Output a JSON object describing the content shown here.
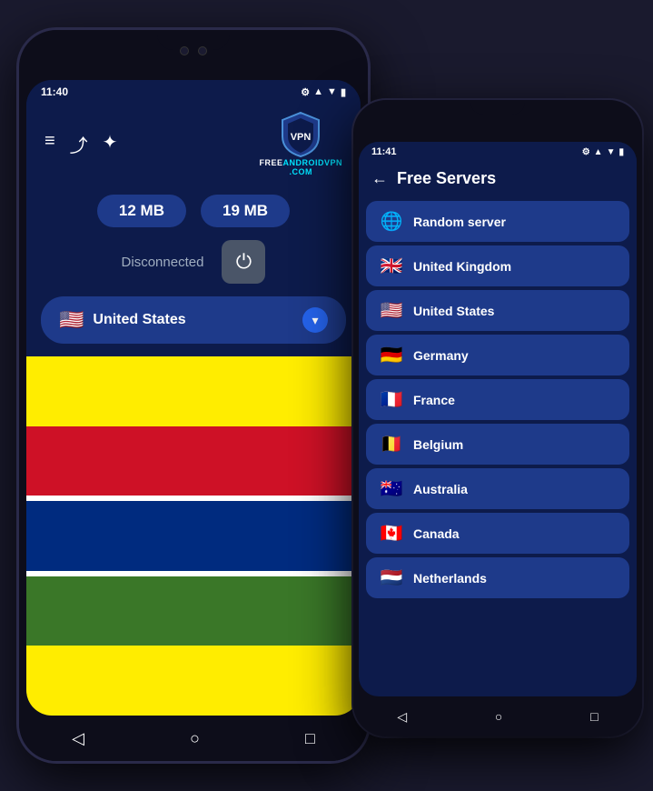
{
  "phone1": {
    "status_bar": {
      "time": "11:40",
      "icons": "▲ ●"
    },
    "stats": {
      "download": "12 MB",
      "upload": "19 MB"
    },
    "connection": {
      "status": "Disconnected"
    },
    "country": {
      "name": "United States",
      "flag": "🇺🇸"
    },
    "logo": {
      "line1": "FREE",
      "line2": "ANDROIDVPN",
      "line3": ".COM"
    },
    "nav": {
      "back": "◁",
      "home": "○",
      "recent": "□"
    }
  },
  "phone2": {
    "status_bar": {
      "time": "11:41",
      "icons": "▲ ●"
    },
    "header": {
      "title": "Free Servers",
      "back": "←"
    },
    "servers": [
      {
        "name": "Random server",
        "flag": "🌐"
      },
      {
        "name": "United Kingdom",
        "flag": "🇬🇧"
      },
      {
        "name": "United States",
        "flag": "🇺🇸"
      },
      {
        "name": "Germany",
        "flag": "🇩🇪"
      },
      {
        "name": "France",
        "flag": "🇫🇷"
      },
      {
        "name": "Belgium",
        "flag": "🇧🇪"
      },
      {
        "name": "Australia",
        "flag": "🇦🇺"
      },
      {
        "name": "Canada",
        "flag": "🇨🇦"
      },
      {
        "name": "Netherlands",
        "flag": "🇳🇱"
      }
    ],
    "nav": {
      "back": "◁",
      "home": "○",
      "recent": "□"
    }
  }
}
